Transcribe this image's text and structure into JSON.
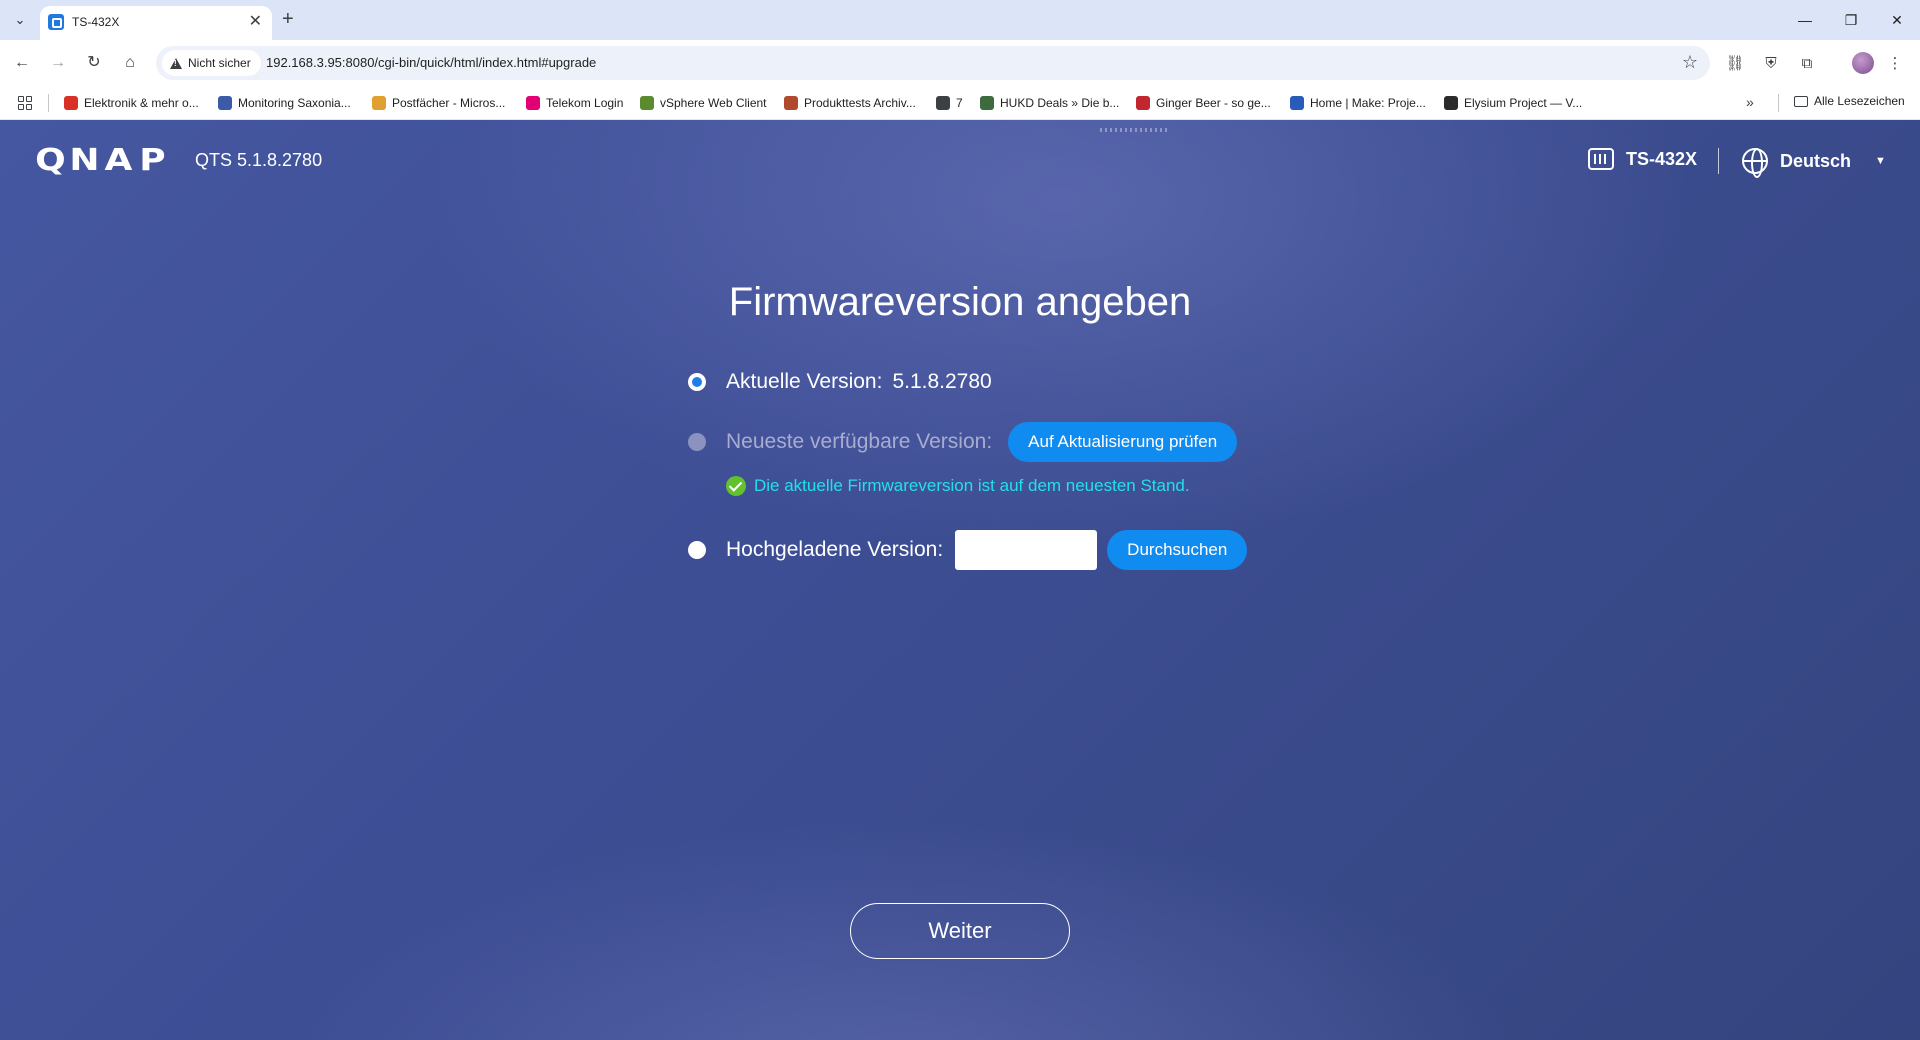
{
  "browser": {
    "tab_title": "TS-432X",
    "new_tab": "+",
    "tab_close": "✕",
    "security_label": "Nicht sicher",
    "url": "192.168.3.95:8080/cgi-bin/quick/html/index.html#upgrade",
    "bookmarks": [
      {
        "label": "Elektronik & mehr o...",
        "color": "#d93025"
      },
      {
        "label": "Monitoring Saxonia...",
        "color": "#3b5ba8"
      },
      {
        "label": "Postfächer - Micros...",
        "color": "#e0a030"
      },
      {
        "label": "Telekom Login",
        "color": "#e20074"
      },
      {
        "label": "vSphere Web Client",
        "color": "#5c8a2f"
      },
      {
        "label": "Produkttests Archiv...",
        "color": "#b04a2e"
      },
      {
        "label": "7",
        "color": "#3c4043"
      },
      {
        "label": "HUKD Deals » Die b...",
        "color": "#3d6b3d"
      },
      {
        "label": "Ginger Beer - so ge...",
        "color": "#c2262e"
      },
      {
        "label": "Home | Make: Proje...",
        "color": "#2a5bb8"
      },
      {
        "label": "Elysium Project — V...",
        "color": "#2b2b2b"
      }
    ],
    "all_bookmarks": "Alle Lesezeichen"
  },
  "header": {
    "logo_letters": [
      "Q",
      "N",
      "A",
      "P"
    ],
    "qts_version": "QTS 5.1.8.2780",
    "device_name": "TS-432X",
    "language": "Deutsch"
  },
  "main": {
    "title": "Firmwareversion angeben",
    "current_label": "Aktuelle Version:",
    "current_value": "5.1.8.2780",
    "latest_label": "Neueste verfügbare Version:",
    "check_button": "Auf Aktualisierung prüfen",
    "status_message": "Die aktuelle Firmwareversion ist auf dem neuesten Stand.",
    "uploaded_label": "Hochgeladene Version:",
    "browse_button": "Durchsuchen",
    "next_button": "Weiter"
  },
  "colors": {
    "accent_blue": "#108bf0",
    "status_cyan": "#23e0e8",
    "check_green": "#62c22b",
    "background": "#3e4e95"
  }
}
